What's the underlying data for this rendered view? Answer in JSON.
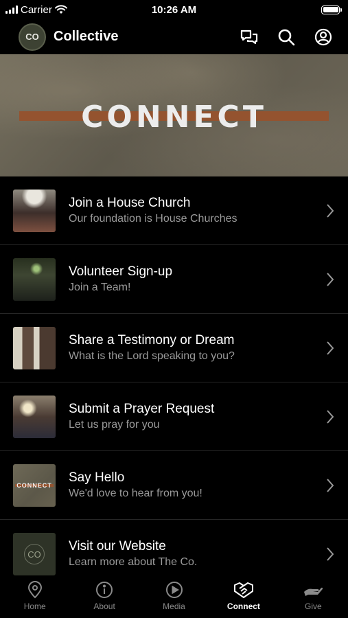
{
  "status_bar": {
    "carrier": "Carrier",
    "time": "10:26 AM"
  },
  "header": {
    "logo_text": "CO",
    "title": "Collective"
  },
  "banner": {
    "title": "CONNECT"
  },
  "list": [
    {
      "title": "Join a House Church",
      "subtitle": "Our foundation is House Churches"
    },
    {
      "title": "Volunteer Sign-up",
      "subtitle": "Join a Team!"
    },
    {
      "title": "Share a Testimony or Dream",
      "subtitle": "What is the Lord speaking to you?"
    },
    {
      "title": "Submit a Prayer Request",
      "subtitle": "Let us pray for you"
    },
    {
      "title": "Say Hello",
      "subtitle": "We'd love to hear from you!",
      "thumb_text": "CONNECT"
    },
    {
      "title": "Visit our Website",
      "subtitle": "Learn more about The Co.",
      "thumb_text": "CO"
    }
  ],
  "tabs": [
    {
      "label": "Home",
      "icon": "location-pin-icon"
    },
    {
      "label": "About",
      "icon": "info-icon"
    },
    {
      "label": "Media",
      "icon": "play-circle-icon"
    },
    {
      "label": "Connect",
      "icon": "handshake-icon",
      "active": true
    },
    {
      "label": "Give",
      "icon": "giving-hand-icon"
    }
  ],
  "colors": {
    "background": "#000000",
    "accent_stripe": "#94532f",
    "subtitle": "#9a9a9a",
    "tab_inactive": "#8a8a8a"
  }
}
